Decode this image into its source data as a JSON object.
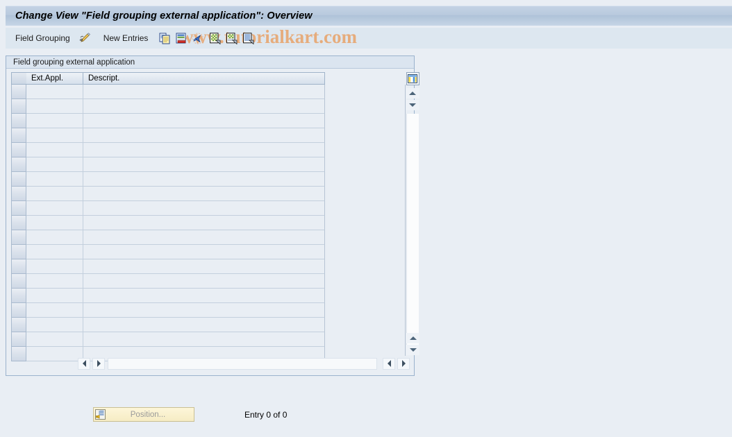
{
  "window": {
    "title": "Change View \"Field grouping external application\": Overview"
  },
  "toolbar": {
    "menu_label": "Field Grouping",
    "display_change_icon": "pencil-display-change-icon",
    "new_entries_label": "New Entries",
    "icons": [
      {
        "name": "copy-icon",
        "title": "Copy As..."
      },
      {
        "name": "delete-row-icon",
        "title": "Delete"
      },
      {
        "name": "undo-icon",
        "title": "Undo Change"
      },
      {
        "name": "select-all-icon",
        "title": "Select All"
      },
      {
        "name": "select-block-icon",
        "title": "Select Block"
      },
      {
        "name": "deselect-all-icon",
        "title": "Deselect All"
      }
    ]
  },
  "watermark": {
    "text": "www.tutorialkart.com",
    "color": "#e8a268"
  },
  "groupbox": {
    "title": "Field grouping external application"
  },
  "table": {
    "columns": [
      {
        "key": "ext_appl",
        "label": "Ext.Appl."
      },
      {
        "key": "descript",
        "label": "Descript."
      }
    ],
    "rows": [],
    "empty_row_count": 19,
    "column_config_icon": "column-configuration-icon"
  },
  "scroll": {
    "up_icon": "scroll-up-icon",
    "down_icon": "scroll-down-icon",
    "left_icon": "scroll-left-icon",
    "right_icon": "scroll-right-icon"
  },
  "footer": {
    "position_button_label": "Position...",
    "position_button_icon": "position-icon",
    "entry_status": "Entry 0 of 0"
  },
  "colors": {
    "background": "#e9eef4",
    "titlebar": "#b9cade",
    "toolbar": "#dde7f0",
    "grid_line": "#c3cfdd",
    "button_yellow": "#fdf6d9"
  }
}
